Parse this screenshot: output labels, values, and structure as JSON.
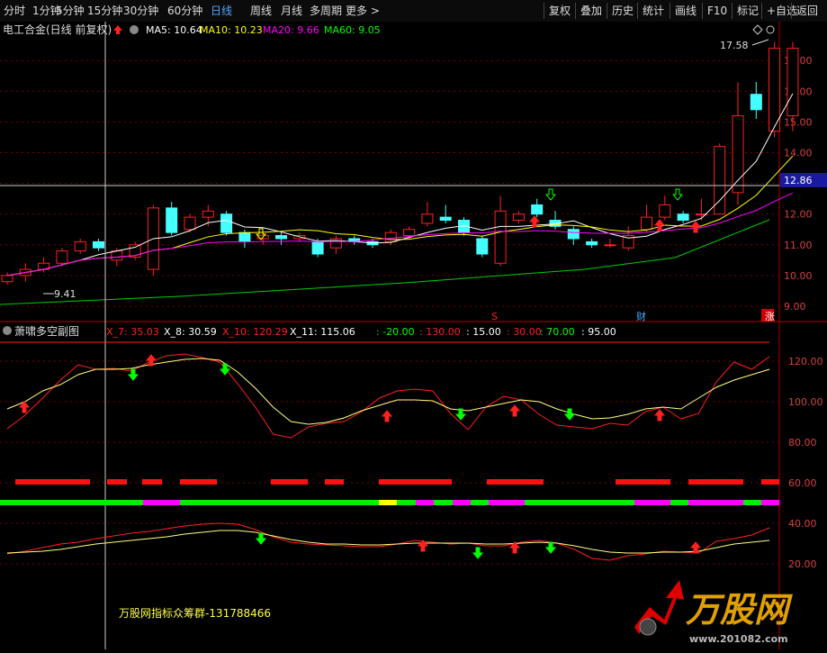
{
  "toolbar": {
    "periods": [
      "分时",
      "1分钟",
      "5分钟",
      "15分钟",
      "30分钟",
      "60分钟",
      "日线",
      "周线",
      "月线",
      "多周期",
      "更多 >"
    ],
    "selected_period": "日线",
    "right_buttons": [
      "复权",
      "叠加",
      "历史",
      "统计",
      "画线",
      "F10",
      "标记",
      "+自选",
      "返回"
    ]
  },
  "main_chart": {
    "stock_title": "电工合金(日线 前复权)",
    "legend": [
      {
        "label": "MA5: 10.64",
        "color": "#ffffff"
      },
      {
        "label": "MA10: 10.23",
        "color": "#ffff00"
      },
      {
        "label": "MA20: 9.66",
        "color": "#ff00ff"
      },
      {
        "label": "MA60: 9.05",
        "color": "#00ff00"
      }
    ],
    "price_axis": [
      "17.00",
      "16.00",
      "15.00",
      "14.00",
      "13.00",
      "12.00",
      "11.00",
      "10.00",
      "9.00"
    ],
    "crosshair_price": "12.86",
    "high_label": "17.58",
    "low_label": "9.41",
    "markers": [
      "S",
      "财",
      "涨"
    ],
    "candles": [
      [
        9.8,
        10.0,
        9.7,
        10.1
      ],
      [
        10.0,
        10.2,
        9.8,
        10.4
      ],
      [
        10.2,
        10.4,
        10.1,
        10.6
      ],
      [
        10.4,
        10.8,
        10.3,
        10.9
      ],
      [
        10.8,
        11.1,
        10.7,
        11.2
      ],
      [
        11.1,
        10.9,
        10.8,
        11.2
      ],
      [
        10.5,
        10.8,
        10.3,
        10.9
      ],
      [
        10.6,
        11.0,
        10.5,
        11.1
      ],
      [
        10.2,
        12.2,
        10.0,
        12.3
      ],
      [
        12.2,
        11.4,
        11.3,
        12.4
      ],
      [
        11.5,
        11.9,
        11.4,
        12.0
      ],
      [
        11.9,
        12.1,
        11.6,
        12.3
      ],
      [
        12.0,
        11.4,
        11.3,
        12.1
      ],
      [
        11.4,
        11.1,
        10.9,
        11.5
      ],
      [
        11.2,
        11.3,
        11.0,
        11.4
      ],
      [
        11.3,
        11.2,
        11.0,
        11.4
      ],
      [
        11.2,
        11.3,
        11.1,
        11.4
      ],
      [
        11.1,
        10.7,
        10.6,
        11.2
      ],
      [
        10.9,
        11.2,
        10.7,
        11.3
      ],
      [
        11.2,
        11.1,
        11.0,
        11.3
      ],
      [
        11.1,
        11.0,
        10.9,
        11.2
      ],
      [
        11.1,
        11.4,
        11.0,
        11.5
      ],
      [
        11.3,
        11.5,
        11.2,
        11.6
      ],
      [
        11.7,
        12.0,
        11.6,
        12.4
      ],
      [
        11.9,
        11.8,
        11.7,
        12.3
      ],
      [
        11.8,
        11.4,
        11.3,
        11.9
      ],
      [
        11.2,
        10.7,
        10.6,
        11.3
      ],
      [
        10.4,
        12.1,
        10.3,
        12.6
      ],
      [
        11.8,
        12.0,
        11.7,
        12.1
      ],
      [
        12.3,
        12.0,
        11.9,
        12.5
      ],
      [
        11.8,
        11.6,
        11.5,
        12.1
      ],
      [
        11.5,
        11.2,
        11.0,
        11.6
      ],
      [
        11.1,
        11.0,
        10.9,
        11.2
      ],
      [
        11.0,
        11.0,
        10.9,
        11.2
      ],
      [
        10.9,
        11.3,
        10.8,
        11.6
      ],
      [
        11.5,
        11.9,
        11.4,
        12.3
      ],
      [
        11.9,
        12.3,
        11.8,
        12.6
      ],
      [
        12.0,
        11.8,
        11.7,
        12.1
      ],
      [
        12.0,
        12.0,
        11.8,
        12.5
      ],
      [
        12.0,
        14.2,
        12.0,
        14.3
      ],
      [
        12.7,
        15.2,
        12.3,
        16.3
      ],
      [
        15.9,
        15.4,
        15.1,
        16.3
      ],
      [
        14.7,
        17.4,
        14.5,
        17.6
      ],
      [
        15.2,
        17.4,
        14.7,
        17.6
      ]
    ]
  },
  "sub_chart": {
    "title": "萧啸多空副图",
    "legend": [
      {
        "label": "X_7: 35.03",
        "color": "#ff2020"
      },
      {
        "label": "X_8: 30.59",
        "color": "#ffffff"
      },
      {
        "label": "X_10: 120.29",
        "color": "#ff2020"
      },
      {
        "label": "X_11: 115.06",
        "color": "#ffffff"
      },
      {
        "label": ": -20.00",
        "color": "#00ff00"
      },
      {
        "label": ": 130.00",
        "color": "#ff2020"
      },
      {
        "label": ": 15.00",
        "color": "#ffffff"
      },
      {
        "label": ": 30.00",
        "color": "#ff2020"
      },
      {
        "label": ": 70.00",
        "color": "#00ff00"
      },
      {
        "label": ": 95.00",
        "color": "#ffffff"
      }
    ],
    "axis": [
      "120.00",
      "100.00",
      "80.00",
      "60.00",
      "40.00",
      "20.00"
    ],
    "watermark_text": "万股网指标众筹群-131788466",
    "logo_text": "万股网",
    "logo_url": "www.201082.com"
  }
}
